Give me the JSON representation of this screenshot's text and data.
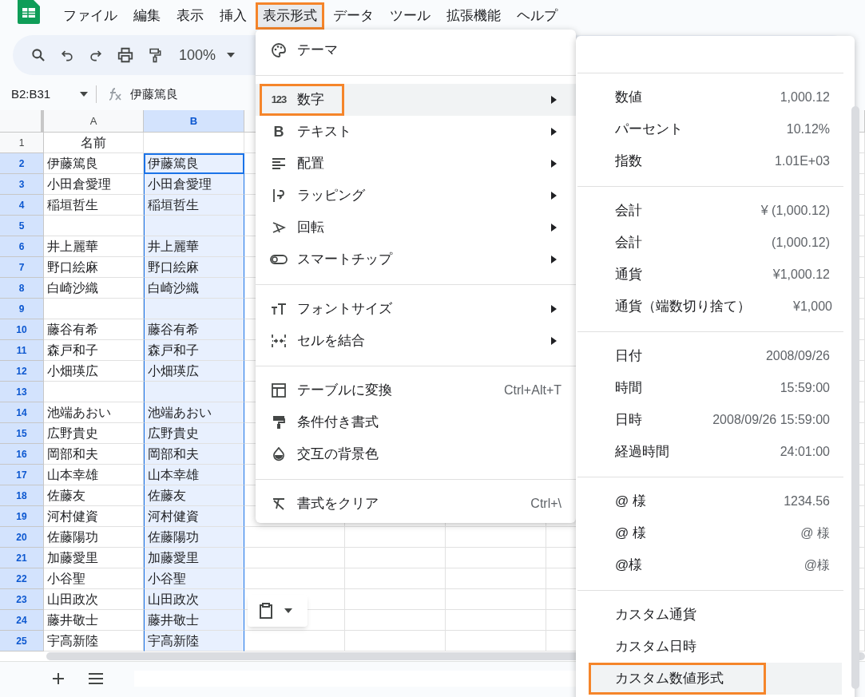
{
  "menubar": [
    {
      "label": "ファイル",
      "selected": false,
      "annotated": false
    },
    {
      "label": "編集",
      "selected": false,
      "annotated": false
    },
    {
      "label": "表示",
      "selected": false,
      "annotated": false
    },
    {
      "label": "挿入",
      "selected": false,
      "annotated": false
    },
    {
      "label": "表示形式",
      "selected": true,
      "annotated": true
    },
    {
      "label": "データ",
      "selected": false,
      "annotated": false
    },
    {
      "label": "ツール",
      "selected": false,
      "annotated": false
    },
    {
      "label": "拡張機能",
      "selected": false,
      "annotated": false
    },
    {
      "label": "ヘルプ",
      "selected": false,
      "annotated": false
    }
  ],
  "toolbar": {
    "zoom": "100%"
  },
  "formula_bar": {
    "range": "B2:B31",
    "content": "伊藤篤良"
  },
  "sheet": {
    "columns": [
      {
        "label": "A",
        "selected": false
      },
      {
        "label": "B",
        "selected": true
      }
    ],
    "rows": [
      {
        "number": "1",
        "selected": false,
        "a": "名前"
      },
      {
        "number": "2",
        "selected": true,
        "a": "伊藤篤良",
        "b": "伊藤篤良"
      },
      {
        "number": "3",
        "selected": true,
        "a": "小田倉愛理",
        "b": "小田倉愛理"
      },
      {
        "number": "4",
        "selected": true,
        "a": "稲垣哲生",
        "b": "稲垣哲生"
      },
      {
        "number": "5",
        "selected": true
      },
      {
        "number": "6",
        "selected": true,
        "a": "井上麗華",
        "b": "井上麗華"
      },
      {
        "number": "7",
        "selected": true,
        "a": "野口絵麻",
        "b": "野口絵麻"
      },
      {
        "number": "8",
        "selected": true,
        "a": "白崎沙織",
        "b": "白崎沙織"
      },
      {
        "number": "9",
        "selected": true
      },
      {
        "number": "10",
        "selected": true,
        "a": "藤谷有希",
        "b": "藤谷有希"
      },
      {
        "number": "11",
        "selected": true,
        "a": "森戸和子",
        "b": "森戸和子"
      },
      {
        "number": "12",
        "selected": true,
        "a": "小畑瑛広",
        "b": "小畑瑛広"
      },
      {
        "number": "13",
        "selected": true
      },
      {
        "number": "14",
        "selected": true,
        "a": "池端あおい",
        "b": "池端あおい"
      },
      {
        "number": "15",
        "selected": true,
        "a": "広野貴史",
        "b": "広野貴史"
      },
      {
        "number": "16",
        "selected": true,
        "a": "岡部和夫",
        "b": "岡部和夫"
      },
      {
        "number": "17",
        "selected": true,
        "a": "山本幸雄",
        "b": "山本幸雄"
      },
      {
        "number": "18",
        "selected": true,
        "a": "佐藤友",
        "b": "佐藤友"
      },
      {
        "number": "19",
        "selected": true,
        "a": "河村健資",
        "b": "河村健資"
      },
      {
        "number": "20",
        "selected": true,
        "a": "佐藤陽功",
        "b": "佐藤陽功"
      },
      {
        "number": "21",
        "selected": true,
        "a": "加藤愛里",
        "b": "加藤愛里"
      },
      {
        "number": "22",
        "selected": true,
        "a": "小谷聖",
        "b": "小谷聖"
      },
      {
        "number": "23",
        "selected": true,
        "a": "山田政次",
        "b": "山田政次"
      },
      {
        "number": "24",
        "selected": true,
        "a": "藤井敬士",
        "b": "藤井敬士"
      },
      {
        "number": "25",
        "selected": true,
        "a": "宇高新陸",
        "b": "宇高新陸"
      }
    ]
  },
  "format_menu": [
    {
      "kind": "item",
      "label": "テーマ",
      "selected": false,
      "annotated": false
    },
    {
      "kind": "separator"
    },
    {
      "kind": "item",
      "icon_label": "123",
      "label": "数字",
      "submenu": true,
      "selected": true,
      "annotated": true
    },
    {
      "kind": "item",
      "icon_label": "B",
      "label": "テキスト",
      "submenu": true,
      "selected": false,
      "annotated": false
    },
    {
      "kind": "item",
      "label": "配置",
      "submenu": true,
      "selected": false,
      "annotated": false
    },
    {
      "kind": "item",
      "label": "ラッピング",
      "submenu": true,
      "selected": false,
      "annotated": false
    },
    {
      "kind": "item",
      "label": "回転",
      "submenu": true,
      "selected": false,
      "annotated": false
    },
    {
      "kind": "item",
      "label": "スマートチップ",
      "submenu": true,
      "selected": false,
      "annotated": false
    },
    {
      "kind": "separator"
    },
    {
      "kind": "item",
      "label": "フォントサイズ",
      "submenu": true,
      "selected": false,
      "annotated": false
    },
    {
      "kind": "item",
      "label": "セルを結合",
      "submenu": true,
      "selected": false,
      "annotated": false
    },
    {
      "kind": "separator"
    },
    {
      "kind": "item",
      "label": "テーブルに変換",
      "shortcut": "Ctrl+Alt+T",
      "selected": false,
      "annotated": false
    },
    {
      "kind": "item",
      "label": "条件付き書式",
      "selected": false,
      "annotated": false
    },
    {
      "kind": "item",
      "label": "交互の背景色",
      "selected": false,
      "annotated": false
    },
    {
      "kind": "separator"
    },
    {
      "kind": "item",
      "label": "書式をクリア",
      "shortcut": "Ctrl+\\",
      "selected": false,
      "annotated": false
    }
  ],
  "number_submenu": [
    [
      {
        "label": "数値",
        "example": "1,000.12",
        "selected": false,
        "annotated": false
      },
      {
        "label": "パーセント",
        "example": "10.12%",
        "selected": false,
        "annotated": false
      },
      {
        "label": "指数",
        "example": "1.01E+03",
        "selected": false,
        "annotated": false
      }
    ],
    [
      {
        "label": "会計",
        "example": "¥ (1,000.12)",
        "selected": false,
        "annotated": false
      },
      {
        "label": "会計",
        "example": "(1,000.12)",
        "selected": false,
        "annotated": false
      },
      {
        "label": "通貨",
        "example": "¥1,000.12",
        "selected": false,
        "annotated": false
      },
      {
        "label": "通貨（端数切り捨て）",
        "example": "¥1,000",
        "selected": false,
        "annotated": false
      }
    ],
    [
      {
        "label": "日付",
        "example": "2008/09/26",
        "selected": false,
        "annotated": false
      },
      {
        "label": "時間",
        "example": "15:59:00",
        "selected": false,
        "annotated": false
      },
      {
        "label": "日時",
        "example": "2008/09/26 15:59:00",
        "selected": false,
        "annotated": false
      },
      {
        "label": "経過時間",
        "example": "24:01:00",
        "selected": false,
        "annotated": false
      }
    ],
    [
      {
        "label": "@ 様",
        "example": "1234.56",
        "selected": false,
        "annotated": false
      },
      {
        "label": "@ 様",
        "example": "@ 様",
        "selected": false,
        "annotated": false
      },
      {
        "label": "@様",
        "example": "@様",
        "selected": false,
        "annotated": false
      }
    ],
    [
      {
        "label": "カスタム通貨",
        "selected": false,
        "annotated": false
      },
      {
        "label": "カスタム日時",
        "selected": false,
        "annotated": false
      },
      {
        "label": "カスタム数値形式",
        "selected": true,
        "annotated": true
      }
    ]
  ]
}
